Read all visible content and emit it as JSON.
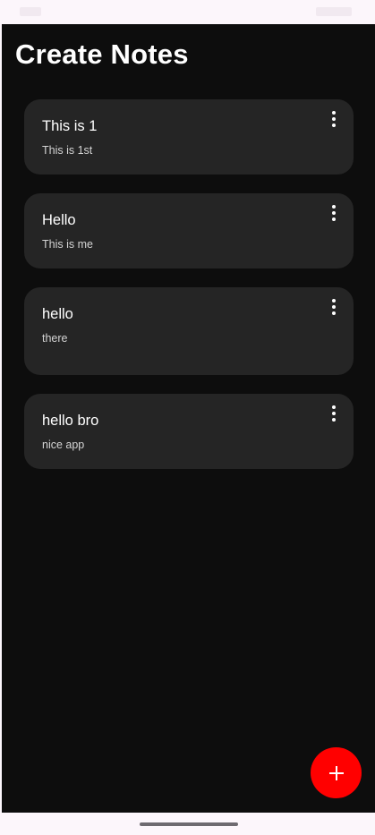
{
  "header": {
    "title": "Create Notes"
  },
  "notes": [
    {
      "title": "This is 1",
      "body": "This is 1st"
    },
    {
      "title": "Hello",
      "body": "This is me"
    },
    {
      "title": "hello",
      "body": "there"
    },
    {
      "title": "hello bro",
      "body": "nice app"
    }
  ],
  "icons": {
    "note_menu": "more-vertical-icon",
    "fab": "plus-icon",
    "nav": "gesture-handle"
  },
  "colors": {
    "background": "#0d0d0d",
    "card": "#252525",
    "fab": "#ff0000",
    "text": "#ffffff",
    "system_bars": "#fcf6fb"
  }
}
